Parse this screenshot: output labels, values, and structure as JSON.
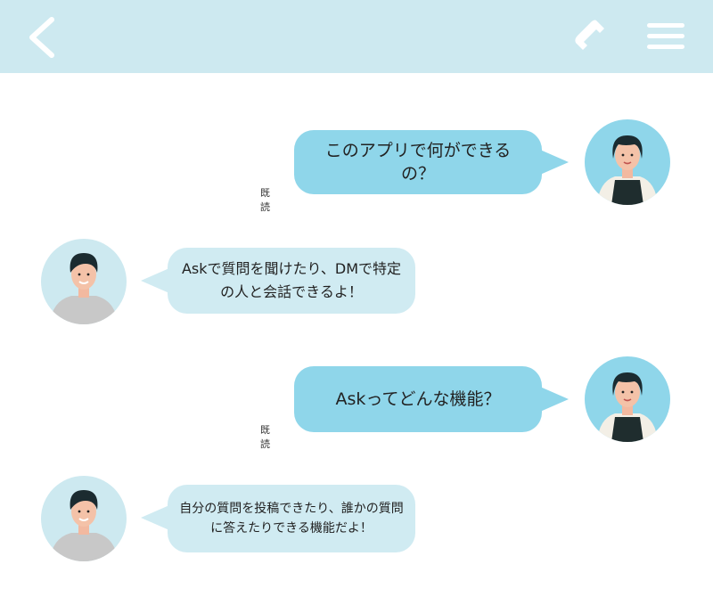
{
  "header": {
    "back_icon": "chevron-left-icon",
    "call_icon": "phone-icon",
    "menu_icon": "hamburger-menu-icon",
    "background": "#cde9f0"
  },
  "messages": [
    {
      "side": "sent",
      "avatar": "woman-avatar",
      "text": "このアプリで何ができるの？",
      "status": "既読"
    },
    {
      "side": "received",
      "avatar": "man-avatar",
      "text": "Askで質問を聞けたり、DMで特定の人と会話できるよ！"
    },
    {
      "side": "sent",
      "avatar": "woman-avatar",
      "text": "Askってどんな機能？",
      "status": "既読"
    },
    {
      "side": "received",
      "avatar": "man-avatar",
      "text": "自分の質問を投稿できたり、誰かの質問に答えたりできる機能だよ！"
    }
  ],
  "colors": {
    "sent_bubble": "#8fd6ea",
    "received_bubble": "#d0ebf2",
    "avatar_bg": "#cde9f0"
  }
}
